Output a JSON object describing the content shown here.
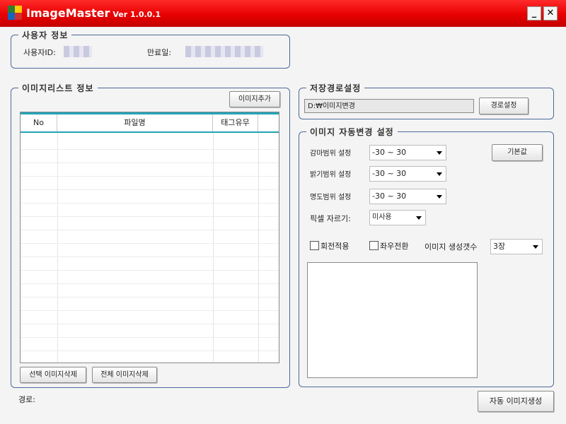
{
  "window": {
    "title": "ImageMaster",
    "version": "Ver 1.0.0.1",
    "minimize_label": "_",
    "close_label": "✕",
    "colors": {
      "titlebar": "#e80000",
      "logo": [
        "#2e7d32",
        "#ffcc00",
        "#1565c0",
        "#d32f2f"
      ]
    }
  },
  "user_info": {
    "title": "사용자 정보",
    "user_id_label": "사용자ID:",
    "expiry_label": "만료일:"
  },
  "image_list": {
    "title": "이미지리스트 정보",
    "add_button": "이미지추가",
    "columns": [
      "No",
      "파일명",
      "태그유무"
    ],
    "rows": [],
    "delete_selected_button": "선택 이미지삭제",
    "delete_all_button": "전체 이미지삭제"
  },
  "save_path": {
    "title": "저장경로설정",
    "path_value": "D:₩이미지변경",
    "set_button": "경로설정"
  },
  "auto_convert": {
    "title": "이미지 자동변경 설정",
    "gamma_label": "감마범위 설정",
    "gamma_value": "-30 ~ 30",
    "brightness_label": "밝기범위 설정",
    "brightness_value": "-30 ~ 30",
    "contrast_label": "명도범위 설정",
    "contrast_value": "-30 ~ 30",
    "pixel_crop_label": "픽셀 자르기:",
    "pixel_crop_value": "미사용",
    "default_button": "기본값",
    "rotate_label": "회전적용",
    "flip_label": "좌우전환",
    "count_label": "이미지 생성갯수",
    "count_value": "3장"
  },
  "footer": {
    "path_label": "경로:",
    "generate_button": "자동 이미지생성"
  }
}
